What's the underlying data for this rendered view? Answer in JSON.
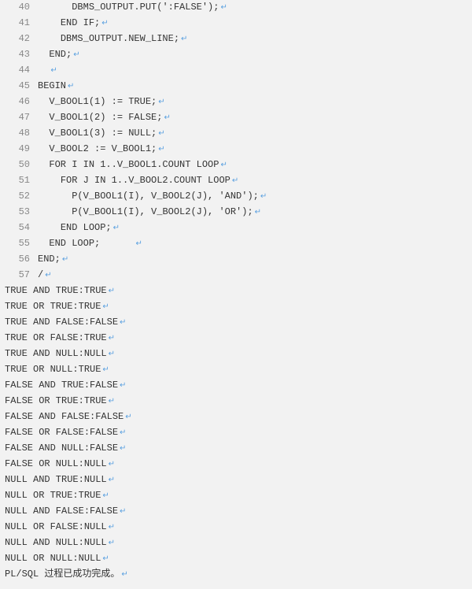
{
  "code_lines": [
    {
      "n": "40",
      "indent": "      ",
      "text": "DBMS_OUTPUT.PUT(':FALSE');",
      "marker": "↵"
    },
    {
      "n": "41",
      "indent": "    ",
      "text": "END IF;",
      "marker": "↵"
    },
    {
      "n": "42",
      "indent": "    ",
      "text": "DBMS_OUTPUT.NEW_LINE;",
      "marker": "↵"
    },
    {
      "n": "43",
      "indent": "  ",
      "text": "END;",
      "marker": "↵"
    },
    {
      "n": "44",
      "indent": "  ",
      "text": "",
      "marker": "↵"
    },
    {
      "n": "45",
      "indent": "",
      "text": "BEGIN",
      "marker": "↵"
    },
    {
      "n": "46",
      "indent": "  ",
      "text": "V_BOOL1(1) := TRUE;",
      "marker": "↵"
    },
    {
      "n": "47",
      "indent": "  ",
      "text": "V_BOOL1(2) := FALSE;",
      "marker": "↵"
    },
    {
      "n": "48",
      "indent": "  ",
      "text": "V_BOOL1(3) := NULL;",
      "marker": "↵"
    },
    {
      "n": "49",
      "indent": "  ",
      "text": "V_BOOL2 := V_BOOL1;",
      "marker": "↵"
    },
    {
      "n": "50",
      "indent": "  ",
      "text": "FOR I IN 1..V_BOOL1.COUNT LOOP",
      "marker": "↵"
    },
    {
      "n": "51",
      "indent": "    ",
      "text": "FOR J IN 1..V_BOOL2.COUNT LOOP",
      "marker": "↵"
    },
    {
      "n": "52",
      "indent": "      ",
      "text": "P(V_BOOL1(I), V_BOOL2(J), 'AND');",
      "marker": "↵"
    },
    {
      "n": "53",
      "indent": "      ",
      "text": "P(V_BOOL1(I), V_BOOL2(J), 'OR');",
      "marker": "↵"
    },
    {
      "n": "54",
      "indent": "    ",
      "text": "END LOOP;",
      "marker": "↵"
    },
    {
      "n": "55",
      "indent": "  ",
      "text": "END LOOP;      ",
      "marker": "↵"
    },
    {
      "n": "56",
      "indent": "",
      "text": "END;",
      "marker": "↵"
    },
    {
      "n": "57",
      "indent": "",
      "text": "/",
      "marker": "↵"
    }
  ],
  "output_lines": [
    {
      "text": "TRUE AND TRUE:TRUE",
      "marker": "↵"
    },
    {
      "text": "TRUE OR TRUE:TRUE",
      "marker": "↵"
    },
    {
      "text": "TRUE AND FALSE:FALSE",
      "marker": "↵"
    },
    {
      "text": "TRUE OR FALSE:TRUE",
      "marker": "↵"
    },
    {
      "text": "TRUE AND NULL:NULL",
      "marker": "↵"
    },
    {
      "text": "TRUE OR NULL:TRUE",
      "marker": "↵"
    },
    {
      "text": "FALSE AND TRUE:FALSE",
      "marker": "↵"
    },
    {
      "text": "FALSE OR TRUE:TRUE",
      "marker": "↵"
    },
    {
      "text": "FALSE AND FALSE:FALSE",
      "marker": "↵"
    },
    {
      "text": "FALSE OR FALSE:FALSE",
      "marker": "↵"
    },
    {
      "text": "FALSE AND NULL:FALSE",
      "marker": "↵"
    },
    {
      "text": "FALSE OR NULL:NULL",
      "marker": "↵"
    },
    {
      "text": "NULL AND TRUE:NULL",
      "marker": "↵"
    },
    {
      "text": "NULL OR TRUE:TRUE",
      "marker": "↵"
    },
    {
      "text": "NULL AND FALSE:FALSE",
      "marker": "↵"
    },
    {
      "text": "NULL OR FALSE:NULL",
      "marker": "↵"
    },
    {
      "text": "NULL AND NULL:NULL",
      "marker": "↵"
    },
    {
      "text": "NULL OR NULL:NULL",
      "marker": "↵"
    },
    {
      "text": "PL/SQL 过程已成功完成。",
      "marker": "↵"
    }
  ]
}
